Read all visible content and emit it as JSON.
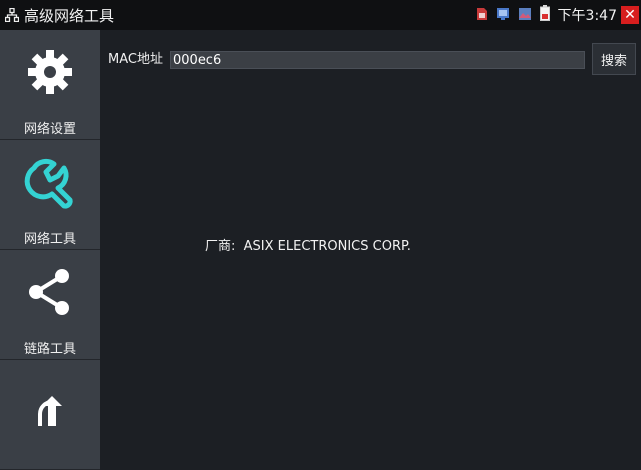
{
  "window": {
    "title": "高级网络工具",
    "app_icon": "network-topology-icon"
  },
  "statusbar": {
    "icons": [
      "sd-card-icon",
      "display-icon",
      "image-icon",
      "battery-icon"
    ],
    "time": "下午3:47",
    "close_icon": "close-icon"
  },
  "sidebar": {
    "items": [
      {
        "label": "网络设置",
        "icon": "gear-icon"
      },
      {
        "label": "网络工具",
        "icon": "wrench-icon",
        "accent": "#34d3d3"
      },
      {
        "label": "链路工具",
        "icon": "share-icon"
      },
      {
        "label": "",
        "icon": "upload-icon"
      }
    ]
  },
  "main": {
    "mac_label": "MAC地址",
    "mac_value": "000ec6",
    "search_label": "搜索",
    "vendor_label": "厂商:",
    "vendor_value": "ASIX ELECTRONICS CORP."
  },
  "colors": {
    "accent": "#34d3d3",
    "close": "#d71e1e",
    "sidebar": "#3a3f46",
    "background": "#1c1f24"
  }
}
